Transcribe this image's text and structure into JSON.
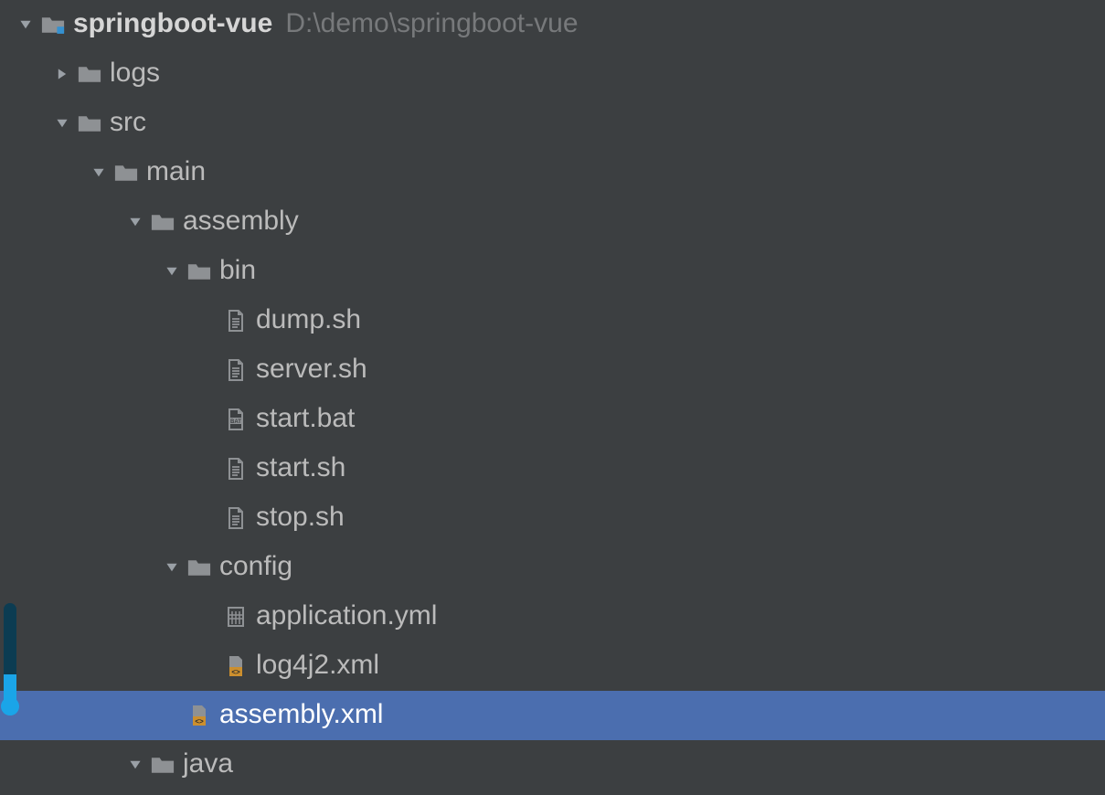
{
  "root": {
    "name": "springboot-vue",
    "path": "D:\\demo\\springboot-vue"
  },
  "nodes": {
    "logs": "logs",
    "src": "src",
    "main": "main",
    "assembly": "assembly",
    "bin": "bin",
    "dump_sh": "dump.sh",
    "server_sh": "server.sh",
    "start_bat": "start.bat",
    "start_sh": "start.sh",
    "stop_sh": "stop.sh",
    "config": "config",
    "application_yml": "application.yml",
    "log4j2_xml": "log4j2.xml",
    "assembly_xml": "assembly.xml",
    "java": "java"
  }
}
